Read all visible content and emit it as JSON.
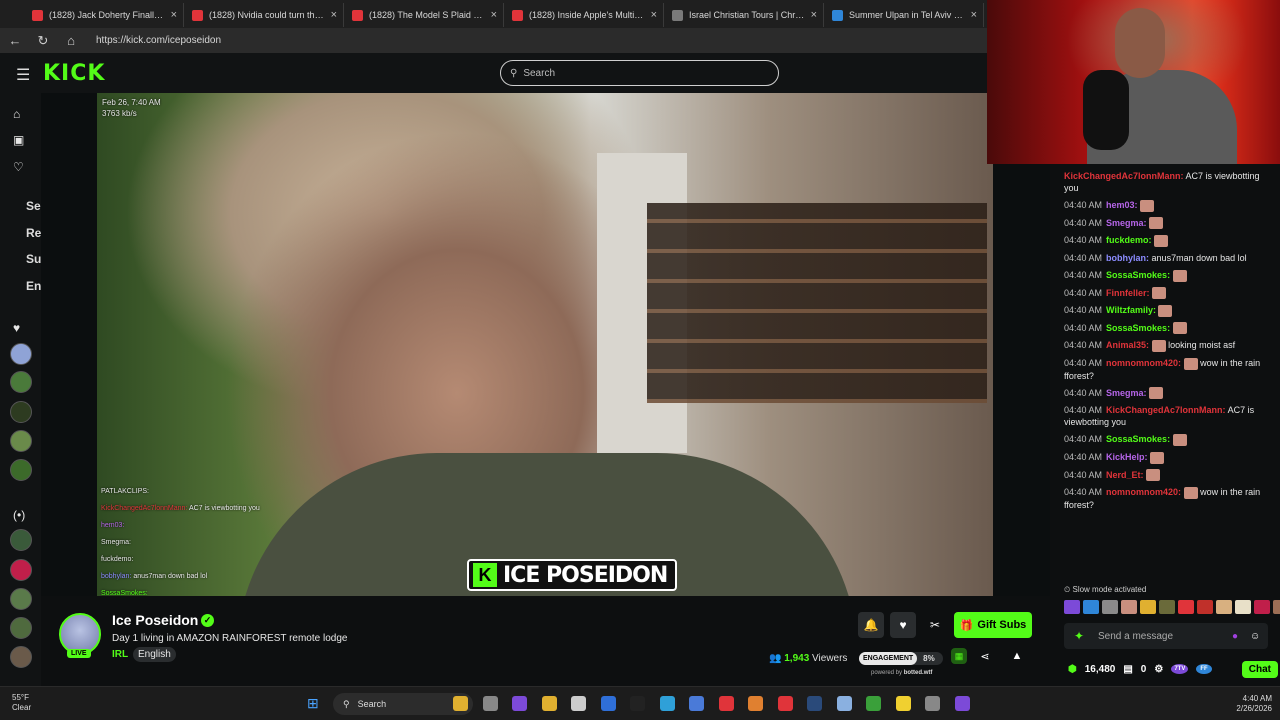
{
  "browser": {
    "tabs": [
      {
        "title": "(1828) Jack Doherty Finally Got H",
        "color": "#e0343a"
      },
      {
        "title": "(1828) Nvidia could turn this who",
        "color": "#e0343a"
      },
      {
        "title": "(1828) The Model S Plaid Walked",
        "color": "#e0343a"
      },
      {
        "title": "(1828) Inside Apple's Multibillion-",
        "color": "#e0343a"
      },
      {
        "title": "Israel Christian Tours | Christian T",
        "color": "#7a7a7a"
      },
      {
        "title": "Summer Ulpan in Tel Aviv - Learn",
        "color": "#2f86d8"
      }
    ],
    "url": "https://kick.com/iceposeidon"
  },
  "kick": {
    "logo": "KICK",
    "search_placeholder": "Search"
  },
  "sidebar": {
    "labels": [
      "Se",
      "Re",
      "Su",
      "En"
    ],
    "avatar_colors": [
      "#8fa3d6",
      "#4a7a3a",
      "#2d3b20",
      "#6a8a4a",
      "#3c6a2a",
      "#3a5a3a",
      "#c01f4a",
      "#5a7a4a",
      "#4f6a3e",
      "#6a5a4a"
    ]
  },
  "video": {
    "timestamp": "Feb 26, 7:40 AM",
    "bitrate": "3763 kb/s",
    "brand": "ICE POSEIDON",
    "overlay_chat": [
      {
        "user": "PATLAKCLIPS:",
        "msg": "",
        "color": "#e6e6e6"
      },
      {
        "user": "KickChangedAc7lonnMann:",
        "msg": "AC7 is viewbotting you",
        "color": "#e0343a"
      },
      {
        "user": "hem03:",
        "msg": "",
        "color": "#b565e8"
      },
      {
        "user": "Smegma:",
        "msg": "",
        "color": "#e6e6e6"
      },
      {
        "user": "fuckdemo:",
        "msg": "",
        "color": "#e6e6e6"
      },
      {
        "user": "bobhylan:",
        "msg": "anus7man down bad lol",
        "color": "#8c8cff"
      },
      {
        "user": "SossaSmokes:",
        "msg": "",
        "color": "#53fc18"
      }
    ]
  },
  "stream": {
    "channel": "Ice Poseidon",
    "live_badge": "LIVE",
    "title": "Day 1 living in AMAZON RAINFOREST remote lodge",
    "category": "IRL",
    "language": "English",
    "viewers_count": "1,943",
    "viewers_label": "Viewers",
    "engagement_label": "ENGAGEMENT",
    "engagement_pct": "8%",
    "powered_by": "powered by",
    "powered_brand": "botted.wtf",
    "gift_subs": "Gift Subs"
  },
  "chat": {
    "messages": [
      {
        "time": "",
        "user": "KickChangedAc7lonnMann:",
        "msg": "AC7 is viewbotting you",
        "color": "#e0343a",
        "emote": false
      },
      {
        "time": "04:40 AM",
        "user": "hem03:",
        "msg": "",
        "color": "#b565e8",
        "emote": true
      },
      {
        "time": "04:40 AM",
        "user": "Smegma:",
        "msg": "",
        "color": "#b565e8",
        "emote": true
      },
      {
        "time": "04:40 AM",
        "user": "fuckdemo:",
        "msg": "",
        "color": "#53fc18",
        "emote": true
      },
      {
        "time": "04:40 AM",
        "user": "bobhylan:",
        "msg": "anus7man down bad lol",
        "color": "#8c8cff",
        "emote": false
      },
      {
        "time": "04:40 AM",
        "user": "SossaSmokes:",
        "msg": "",
        "color": "#53fc18",
        "emote": true
      },
      {
        "time": "04:40 AM",
        "user": "Finnfeller:",
        "msg": "",
        "color": "#e0343a",
        "emote": true
      },
      {
        "time": "04:40 AM",
        "user": "Wiltzfamily:",
        "msg": "",
        "color": "#53fc18",
        "emote": true
      },
      {
        "time": "04:40 AM",
        "user": "SossaSmokes:",
        "msg": "",
        "color": "#53fc18",
        "emote": true
      },
      {
        "time": "04:40 AM",
        "user": "Animal35:",
        "msg": "looking moist asf",
        "color": "#e0343a",
        "emote": true
      },
      {
        "time": "04:40 AM",
        "user": "nomnomnom420:",
        "msg": "wow in the rain fforest?",
        "color": "#e0343a",
        "emote": true
      },
      {
        "time": "04:40 AM",
        "user": "Smegma:",
        "msg": "",
        "color": "#b565e8",
        "emote": true
      },
      {
        "time": "04:40 AM",
        "user": "KickChangedAc7lonnMann:",
        "msg": "AC7 is viewbotting you",
        "color": "#e0343a",
        "emote": false
      },
      {
        "time": "04:40 AM",
        "user": "SossaSmokes:",
        "msg": "",
        "color": "#53fc18",
        "emote": true
      },
      {
        "time": "04:40 AM",
        "user": "KickHelp:",
        "msg": "",
        "color": "#b565e8",
        "emote": true
      },
      {
        "time": "04:40 AM",
        "user": "Nerd_Et:",
        "msg": "",
        "color": "#e0343a",
        "emote": true
      },
      {
        "time": "04:40 AM",
        "user": "nomnomnom420:",
        "msg": "wow in the rain fforest?",
        "color": "#e0343a",
        "emote": true
      }
    ],
    "slow_mode": "Slow mode activated",
    "input_placeholder": "Send a message",
    "points": "16,480",
    "zero": "0",
    "chat_button": "Chat",
    "badge_7tv": "7TV",
    "badge_ff": "FF"
  },
  "taskbar": {
    "temp": "55°F",
    "weather": "Clear",
    "search": "Search",
    "time": "4:40 AM",
    "date": "2/26/2026"
  }
}
